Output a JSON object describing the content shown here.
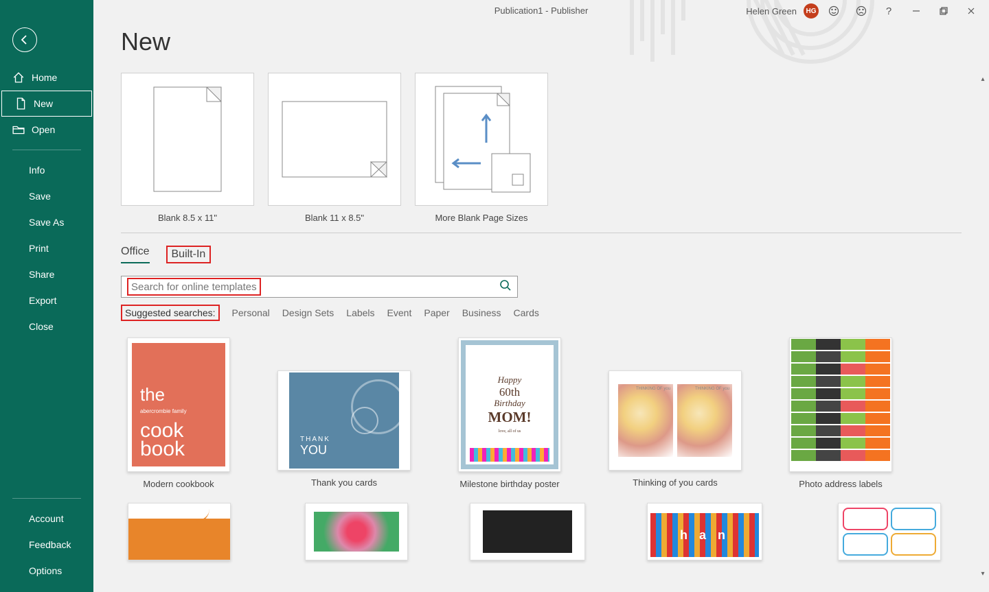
{
  "window_title": "Publication1  -  Publisher",
  "user": {
    "name": "Helen Green",
    "initials": "HG"
  },
  "sidebar": {
    "home": "Home",
    "new": "New",
    "open": "Open",
    "info": "Info",
    "save": "Save",
    "save_as": "Save As",
    "print": "Print",
    "share": "Share",
    "export": "Export",
    "close": "Close",
    "account": "Account",
    "feedback": "Feedback",
    "options": "Options"
  },
  "page_title": "New",
  "blank_templates": [
    {
      "label": "Blank 8.5 x 11\""
    },
    {
      "label": "Blank 11 x 8.5\""
    },
    {
      "label": "More Blank Page Sizes"
    }
  ],
  "tabs": {
    "office": "Office",
    "builtin": "Built-In"
  },
  "search": {
    "placeholder": "Search for online templates"
  },
  "suggested_label": "Suggested searches:",
  "suggested": [
    "Personal",
    "Design Sets",
    "Labels",
    "Event",
    "Paper",
    "Business",
    "Cards"
  ],
  "templates": [
    {
      "label": "Modern cookbook"
    },
    {
      "label": "Thank you cards"
    },
    {
      "label": "Milestone birthday poster"
    },
    {
      "label": "Thinking of you cards"
    },
    {
      "label": "Photo address labels"
    }
  ],
  "cookbook_art": {
    "t1": "the",
    "t2": "abercrombie family",
    "t3a": "cook",
    "t3b": "book"
  },
  "thankyou_art": {
    "t1": "THANK",
    "t2": "YOU"
  },
  "milestone_art": {
    "l1": "Happy",
    "l2": "60th",
    "l3": "Birthday",
    "l4": "MOM!",
    "l5": "love, all of us"
  },
  "thinking_art": {
    "cap": "THINKING OF\nyou"
  }
}
